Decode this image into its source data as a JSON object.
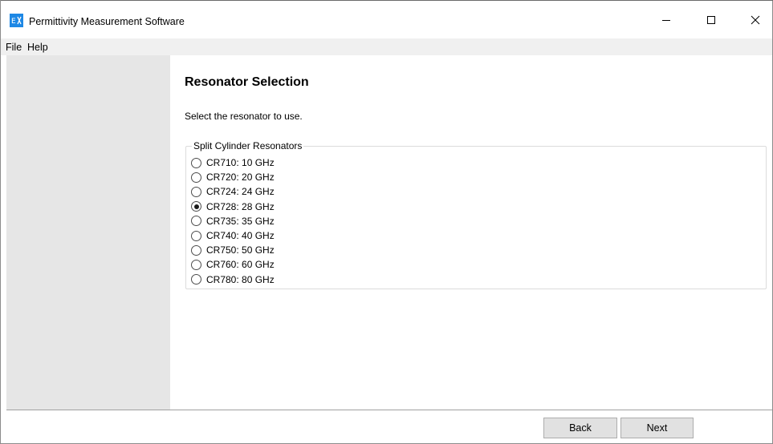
{
  "window": {
    "title": "Permittivity Measurement Software",
    "icon": "app-logo-icon",
    "controls": [
      "minimize-icon",
      "maximize-icon",
      "close-icon"
    ]
  },
  "menu": {
    "items": [
      {
        "label": "File"
      },
      {
        "label": "Help"
      }
    ]
  },
  "page": {
    "heading": "Resonator Selection",
    "instruction": "Select the resonator to use."
  },
  "group": {
    "title": "Split Cylinder Resonators",
    "selected": "CR728: 28 GHz",
    "options": [
      {
        "label": "CR710: 10 GHz",
        "checked": false
      },
      {
        "label": "CR720: 20 GHz",
        "checked": false
      },
      {
        "label": "CR724: 24 GHz",
        "checked": false
      },
      {
        "label": "CR728: 28 GHz",
        "checked": true
      },
      {
        "label": "CR735: 35 GHz",
        "checked": false
      },
      {
        "label": "CR740: 40 GHz",
        "checked": false
      },
      {
        "label": "CR750: 50 GHz",
        "checked": false
      },
      {
        "label": "CR760: 60 GHz",
        "checked": false
      },
      {
        "label": "CR780: 80 GHz",
        "checked": false
      }
    ]
  },
  "buttons": {
    "back": "Back",
    "next": "Next"
  },
  "colors": {
    "sidebar": "#e6e6e6",
    "menubar": "#f0f0f0",
    "button_face": "#e1e1e1",
    "icon_blue": "#1e88e5"
  }
}
